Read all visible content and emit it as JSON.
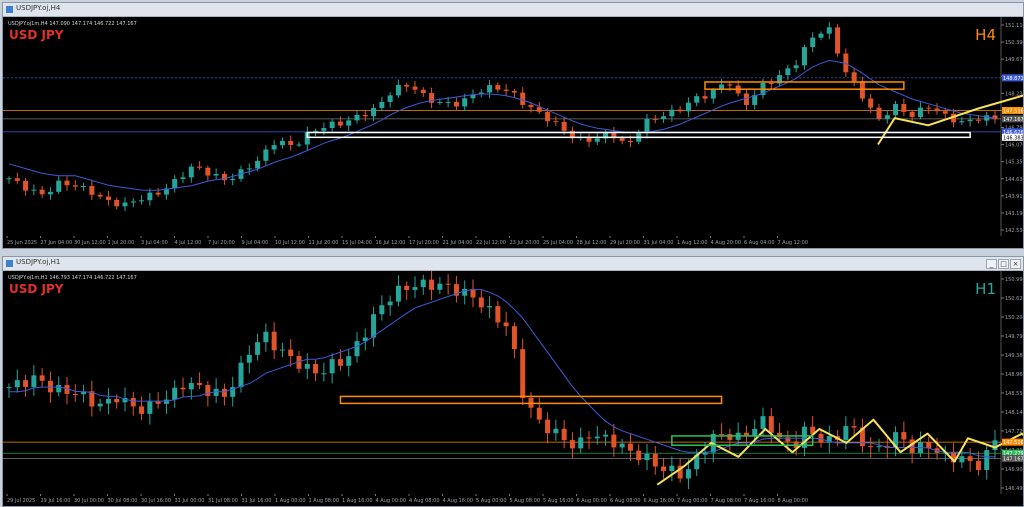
{
  "colors": {
    "bg": "#000000",
    "up": "#26a69a",
    "down": "#e0542a",
    "ma": "#3d5ad8",
    "zigzag": "#f5e15a",
    "orange": "#ff8c00",
    "green": "#2dbf5a",
    "white": "#ffffff",
    "axis": "#9aa0a6",
    "level_blue": "#3b5bdb"
  },
  "window_icons": [
    "minimize-icon",
    "maximize-icon",
    "close-icon"
  ],
  "top": {
    "window_title": "USDJPY.oj,H4",
    "header": "USDJPY.oj1m,H4   147.090 147.174 146.722 147.167",
    "symbol": "USD JPY",
    "timeframe": "H4",
    "price_ticks": [
      "151.110",
      "150.390",
      "149.670",
      "148.950",
      "148.230",
      "147.510",
      "146.790",
      "146.070",
      "145.350",
      "144.630",
      "143.910",
      "143.190",
      "142.530"
    ],
    "time_ticks": [
      "25 Jun 2025",
      "27 Jun 04:00",
      "30 Jun 12:00",
      "1 Jul 20:00",
      "3 Jul 04:00",
      "4 Jul 12:00",
      "7 Jul 20:00",
      "9 Jul 04:00",
      "10 Jul 12:00",
      "11 Jul 20:00",
      "15 Jul 04:00",
      "16 Jul 12:00",
      "17 Jul 20:00",
      "21 Jul 04:00",
      "22 Jul 12:00",
      "23 Jul 20:00",
      "25 Jul 04:00",
      "28 Jul 12:00",
      "29 Jul 20:00",
      "31 Jul 04:00",
      "1 Aug 12:00",
      "4 Aug 20:00",
      "6 Aug 04:00",
      "7 Aug 12:00"
    ],
    "price_labels": [
      {
        "text": "148.871",
        "kind": "blue"
      },
      {
        "text": "147.516",
        "kind": "orange"
      },
      {
        "text": "147.167",
        "kind": "gray"
      },
      {
        "text": "146.626",
        "kind": "blue"
      },
      {
        "text": "146.383",
        "kind": "white"
      }
    ],
    "chart_data": {
      "type": "candlestick",
      "title": "USD JPY",
      "timeframe": "H4",
      "ylim": [
        142.3,
        151.4
      ],
      "close_path": [
        144.7,
        144.3,
        144.0,
        144.5,
        144.4,
        144.1,
        143.7,
        143.6,
        143.9,
        144.1,
        144.6,
        145.2,
        144.9,
        144.6,
        145.0,
        145.5,
        146.3,
        146.0,
        146.6,
        146.9,
        147.0,
        147.3,
        147.6,
        148.4,
        148.6,
        148.0,
        147.8,
        147.8,
        148.3,
        148.5,
        148.3,
        147.7,
        147.3,
        146.8,
        146.3,
        146.3,
        146.6,
        146.0,
        147.0,
        147.3,
        147.5,
        148.0,
        148.2,
        148.8,
        147.7,
        148.5,
        148.9,
        149.4,
        150.5,
        151.0,
        149.2,
        148.2,
        147.1,
        147.7,
        147.3,
        147.7,
        147.3,
        147.0,
        147.2,
        147.2
      ],
      "ma_path": [
        145.3,
        145.1,
        144.9,
        144.8,
        144.8,
        144.6,
        144.4,
        144.3,
        144.2,
        144.2,
        144.3,
        144.4,
        144.6,
        144.7,
        144.9,
        145.1,
        145.4,
        145.6,
        145.9,
        146.2,
        146.4,
        146.7,
        147.0,
        147.4,
        147.7,
        147.9,
        148.0,
        148.1,
        148.2,
        148.2,
        148.1,
        147.9,
        147.6,
        147.3,
        147.0,
        146.8,
        146.7,
        146.6,
        146.6,
        146.7,
        146.9,
        147.2,
        147.5,
        147.8,
        148.0,
        148.2,
        148.5,
        148.8,
        149.3,
        149.6,
        149.5,
        149.1,
        148.6,
        148.3,
        148.0,
        147.8,
        147.6,
        147.4,
        147.3,
        147.2
      ],
      "zigzag": [
        [
          52,
          146.1
        ],
        [
          53,
          147.2
        ],
        [
          55,
          146.9
        ],
        [
          58,
          147.6
        ],
        [
          62,
          148.4
        ],
        [
          63,
          147.9
        ],
        [
          65,
          148.3
        ],
        [
          66,
          147.5
        ],
        [
          69,
          148.4
        ],
        [
          70,
          147.8
        ],
        [
          72,
          149.2
        ],
        [
          75,
          148.3
        ],
        [
          77,
          150.2
        ],
        [
          79,
          151.0
        ],
        [
          80,
          150.6
        ],
        [
          81,
          148.3
        ],
        [
          82,
          147.9
        ],
        [
          83,
          147.8
        ],
        [
          84,
          147.4
        ],
        [
          86,
          147.6
        ],
        [
          88,
          147.0
        ],
        [
          90,
          147.4
        ],
        [
          92,
          147.6
        ],
        [
          94,
          147.3
        ],
        [
          96,
          147.0
        ],
        [
          97,
          147.2
        ]
      ],
      "zones": [
        {
          "color": "orange",
          "y_top": 148.7,
          "y_bottom": 148.4,
          "x_from": 84,
          "x_to": 108
        },
        {
          "color": "white",
          "y_top": 146.6,
          "y_bottom": 146.4,
          "x_from": 36,
          "x_to": 116
        }
      ],
      "levels": [
        {
          "price": 148.871,
          "color": "blue",
          "dotted": true
        },
        {
          "price": 147.516,
          "color": "orange"
        },
        {
          "price": 147.167,
          "color": "gray"
        },
        {
          "price": 146.626,
          "color": "blue"
        }
      ]
    }
  },
  "bottom": {
    "window_title": "USDJPY.oj,H1",
    "header": "USDJPY.oj1m,H1   146.793 147.174 146.722 147.167",
    "symbol": "USD JPY",
    "timeframe": "H1",
    "price_ticks": [
      "150.990",
      "150.620",
      "150.200",
      "149.790",
      "149.380",
      "148.960",
      "148.550",
      "148.140",
      "147.720",
      "147.310",
      "146.900",
      "146.490"
    ],
    "time_ticks": [
      "29 Jul 2025",
      "29 Jul 16:00",
      "30 Jul 00:00",
      "30 Jul 08:00",
      "30 Jul 16:00",
      "31 Jul 00:00",
      "31 Jul 08:00",
      "31 Jul 16:00",
      "1 Aug 00:00",
      "1 Aug 08:00",
      "1 Aug 16:00",
      "4 Aug 00:00",
      "4 Aug 08:00",
      "4 Aug 16:00",
      "5 Aug 00:00",
      "5 Aug 08:00",
      "5 Aug 16:00",
      "6 Aug 00:00",
      "6 Aug 08:00",
      "6 Aug 16:00",
      "7 Aug 00:00",
      "7 Aug 08:00",
      "7 Aug 16:00",
      "8 Aug 00:00"
    ],
    "price_labels": [
      {
        "text": "147.516",
        "kind": "orange"
      },
      {
        "text": "147.279",
        "kind": "green"
      },
      {
        "text": "147.167",
        "kind": "gray"
      }
    ],
    "chart_data": {
      "type": "candlestick",
      "title": "USD JPY",
      "timeframe": "H1",
      "ylim": [
        146.4,
        151.2
      ],
      "close_path": [
        148.7,
        148.8,
        148.9,
        148.7,
        148.6,
        148.6,
        148.4,
        148.3,
        148.5,
        148.3,
        148.2,
        148.4,
        148.5,
        148.8,
        148.7,
        148.6,
        148.5,
        149.0,
        149.6,
        149.8,
        149.5,
        149.3,
        149.1,
        149.0,
        149.2,
        149.3,
        149.7,
        150.2,
        150.6,
        150.8,
        150.9,
        150.9,
        150.9,
        150.8,
        150.7,
        150.5,
        150.2,
        150.0,
        148.6,
        148.0,
        147.8,
        147.6,
        147.4,
        147.7,
        147.6,
        147.5,
        147.3,
        147.2,
        147.0,
        146.9,
        146.8,
        147.2,
        147.6,
        147.7,
        147.6,
        147.8,
        148.0,
        147.6,
        147.4,
        147.8,
        147.6,
        147.5,
        147.9,
        147.6,
        147.3,
        147.5,
        147.7,
        147.3,
        147.5,
        147.2,
        147.2,
        147.1,
        147.0,
        147.6
      ],
      "ma_path": [
        148.6,
        148.6,
        148.7,
        148.7,
        148.7,
        148.6,
        148.6,
        148.5,
        148.5,
        148.4,
        148.4,
        148.4,
        148.4,
        148.5,
        148.5,
        148.6,
        148.6,
        148.7,
        148.8,
        149.0,
        149.1,
        149.2,
        149.3,
        149.3,
        149.4,
        149.5,
        149.6,
        149.8,
        150.0,
        150.2,
        150.4,
        150.5,
        150.6,
        150.7,
        150.8,
        150.8,
        150.7,
        150.5,
        150.2,
        149.8,
        149.4,
        149.0,
        148.6,
        148.3,
        148.0,
        147.8,
        147.7,
        147.6,
        147.5,
        147.4,
        147.3,
        147.3,
        147.3,
        147.4,
        147.5,
        147.5,
        147.6,
        147.6,
        147.6,
        147.6,
        147.6,
        147.5,
        147.5,
        147.5,
        147.5,
        147.4,
        147.4,
        147.4,
        147.4,
        147.3,
        147.3,
        147.3,
        147.2,
        147.2
      ],
      "zigzag": [
        [
          48,
          146.6
        ],
        [
          50,
          147.0
        ],
        [
          52,
          147.5
        ],
        [
          54,
          147.2
        ],
        [
          56,
          147.8
        ],
        [
          58,
          147.3
        ],
        [
          60,
          147.8
        ],
        [
          62,
          147.5
        ],
        [
          64,
          148.0
        ],
        [
          66,
          147.3
        ],
        [
          68,
          147.7
        ],
        [
          70,
          147.1
        ],
        [
          71,
          147.6
        ],
        [
          73,
          147.4
        ],
        [
          75,
          147.7
        ],
        [
          77,
          147.1
        ],
        [
          79,
          147.5
        ],
        [
          81,
          147.1
        ],
        [
          83,
          147.6
        ],
        [
          85,
          147.2
        ],
        [
          86,
          147.0
        ]
      ],
      "zones": [
        {
          "color": "orange",
          "y_top": 148.5,
          "y_bottom": 148.35,
          "x_from": 40,
          "x_to": 86
        },
        {
          "color": "green",
          "y_top": 147.65,
          "y_bottom": 147.45,
          "x_from": 80,
          "x_to": 97
        }
      ],
      "levels": [
        {
          "price": 147.516,
          "color": "orange"
        },
        {
          "price": 147.279,
          "color": "green"
        },
        {
          "price": 147.167,
          "color": "gray"
        }
      ]
    }
  }
}
